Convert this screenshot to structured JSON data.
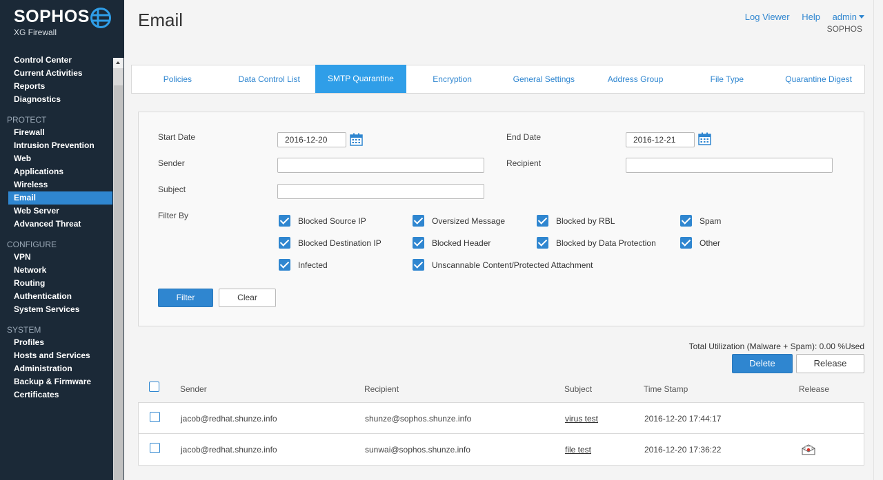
{
  "brand": {
    "name": "SOPHOS",
    "product": "XG Firewall"
  },
  "nav": {
    "top_items": [
      "Control Center",
      "Current Activities",
      "Reports",
      "Diagnostics"
    ],
    "protect": {
      "title": "PROTECT",
      "items": [
        "Firewall",
        "Intrusion Prevention",
        "Web",
        "Applications",
        "Wireless",
        "Email",
        "Web Server",
        "Advanced Threat"
      ]
    },
    "configure": {
      "title": "CONFIGURE",
      "items": [
        "VPN",
        "Network",
        "Routing",
        "Authentication",
        "System Services"
      ]
    },
    "system": {
      "title": "SYSTEM",
      "items": [
        "Profiles",
        "Hosts and Services",
        "Administration",
        "Backup & Firmware",
        "Certificates"
      ]
    },
    "active_item": "Email"
  },
  "header": {
    "title": "Email",
    "log_viewer": "Log Viewer",
    "help": "Help",
    "user": "admin",
    "org": "SOPHOS"
  },
  "tabs": [
    "Policies",
    "Data Control List",
    "SMTP Quarantine",
    "Encryption",
    "General Settings",
    "Address Group",
    "File Type",
    "Quarantine Digest"
  ],
  "active_tab": "SMTP Quarantine",
  "filter": {
    "start_date_label": "Start Date",
    "start_date_value": "2016-12-20",
    "end_date_label": "End Date",
    "end_date_value": "2016-12-21",
    "sender_label": "Sender",
    "sender_value": "",
    "recipient_label": "Recipient",
    "recipient_value": "",
    "subject_label": "Subject",
    "subject_value": "",
    "filter_by_label": "Filter By",
    "checkboxes": [
      {
        "label": "Blocked Source IP",
        "checked": true
      },
      {
        "label": "Oversized Message",
        "checked": true
      },
      {
        "label": "Blocked by RBL",
        "checked": true
      },
      {
        "label": "Spam",
        "checked": true
      },
      {
        "label": "Blocked Destination IP",
        "checked": true
      },
      {
        "label": "Blocked Header",
        "checked": true
      },
      {
        "label": "Blocked by Data Protection",
        "checked": true
      },
      {
        "label": "Other",
        "checked": true
      },
      {
        "label": "Infected",
        "checked": true
      },
      {
        "label": "Unscannable Content/Protected Attachment",
        "checked": true
      }
    ],
    "filter_button": "Filter",
    "clear_button": "Clear"
  },
  "utilization": "Total Utilization (Malware + Spam): 0.00 %Used",
  "actions": {
    "delete": "Delete",
    "release": "Release"
  },
  "table": {
    "columns": [
      "Sender",
      "Recipient",
      "Subject",
      "Time Stamp",
      "Release"
    ],
    "rows": [
      {
        "sender": "jacob@redhat.shunze.info",
        "recipient": "shunze@sophos.shunze.info",
        "subject": "virus test",
        "timestamp": "2016-12-20 17:44:17",
        "releasable": false
      },
      {
        "sender": "jacob@redhat.shunze.info",
        "recipient": "sunwai@sophos.shunze.info",
        "subject": "file test",
        "timestamp": "2016-12-20 17:36:22",
        "releasable": true
      }
    ]
  },
  "colors": {
    "sidebar_bg": "#1b2937",
    "accent": "#2f86d0",
    "active_tab": "#2f9ee8"
  }
}
